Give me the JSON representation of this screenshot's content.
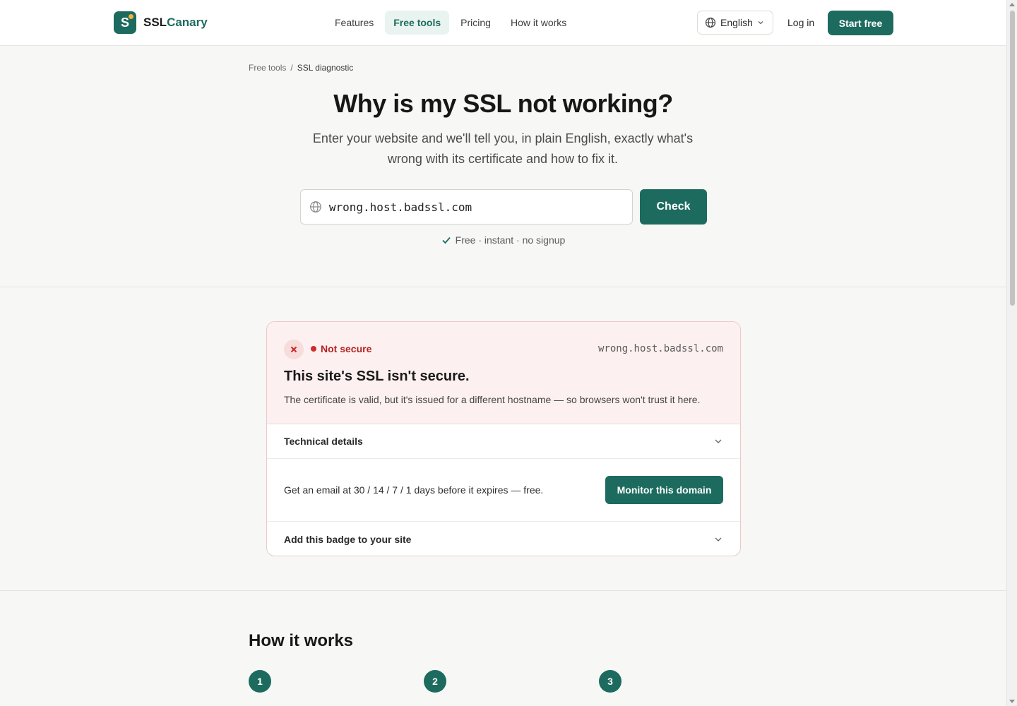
{
  "header": {
    "brand": {
      "prefix": "SSL",
      "suffix": "Canary",
      "logo_letter": "S"
    },
    "nav": [
      "Features",
      "Free tools",
      "Pricing",
      "How it works"
    ],
    "active_nav": "Free tools",
    "language": "English",
    "login_label": "Log in",
    "start_label": "Start free"
  },
  "breadcrumb": {
    "parent": "Free tools",
    "separator": "/",
    "current": "SSL diagnostic"
  },
  "hero": {
    "title": "Why is my SSL not working?",
    "subtitle": "Enter your website and we'll tell you, in plain English, exactly what's wrong with its certificate and how to fix it.",
    "input_value": "wrong.host.badssl.com",
    "check_label": "Check",
    "note": "Free · instant · no signup"
  },
  "result": {
    "status": "Not secure",
    "host": "wrong.host.badssl.com",
    "title": "This site's SSL isn't secure.",
    "description": "The certificate is valid, but it's issued for a different hostname — so browsers won't trust it here.",
    "technical_label": "Technical details",
    "monitor_text": "Get an email at 30 / 14 / 7 / 1 days before it expires — free.",
    "monitor_label": "Monitor this domain",
    "badge_label": "Add this badge to your site"
  },
  "how": {
    "title": "How it works",
    "steps": [
      "1",
      "2",
      "3"
    ]
  },
  "colors": {
    "brand": "#1d6b5f",
    "danger": "#d02a2a",
    "danger_bg": "#fdf0f0",
    "accent_dot": "#f2b23a"
  },
  "icons": {
    "globe": "globe-icon",
    "chevron": "chevron-down-icon",
    "check": "check-icon",
    "close": "close-icon"
  }
}
